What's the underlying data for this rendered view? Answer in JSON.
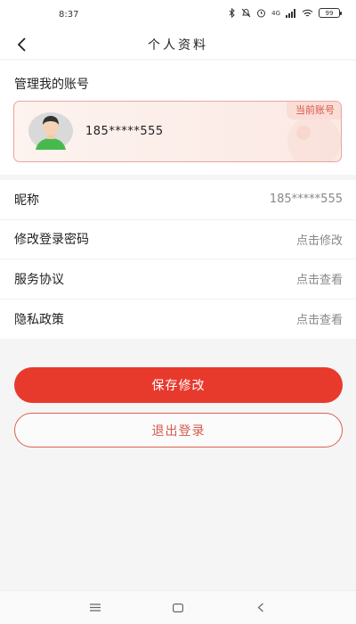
{
  "status_bar": {
    "time": "8:37",
    "signal_text": "4G",
    "battery": "99"
  },
  "header": {
    "title": "个人资料"
  },
  "account": {
    "section_title": "管理我的账号",
    "phone": "185*****555",
    "badge": "当前账号"
  },
  "menu": [
    {
      "label": "昵称",
      "value": "185*****555"
    },
    {
      "label": "修改登录密码",
      "value": "点击修改"
    },
    {
      "label": "服务协议",
      "value": "点击查看"
    },
    {
      "label": "隐私政策",
      "value": "点击查看"
    }
  ],
  "actions": {
    "save_label": "保存修改",
    "logout_label": "退出登录"
  },
  "colors": {
    "primary": "#e8392d",
    "accent_text": "#d7584a",
    "card_border": "#e6a79d"
  }
}
